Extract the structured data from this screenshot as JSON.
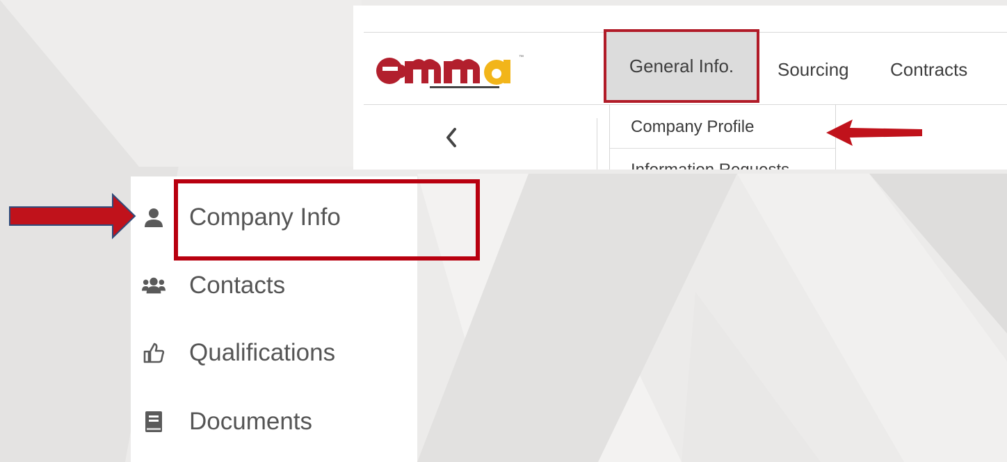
{
  "logo": {
    "text": "emma",
    "tagline": "maryland marketplace advantage",
    "icon": "emma-logo"
  },
  "nav": {
    "items": [
      {
        "label": "General Info.",
        "active": true
      },
      {
        "label": "Sourcing"
      },
      {
        "label": "Contracts"
      }
    ]
  },
  "back_button": {
    "icon": "chevron-left-icon"
  },
  "dropdown": {
    "items": [
      "Company Profile",
      "Information Requests"
    ]
  },
  "sidebar": {
    "items": [
      {
        "label": "Company Info",
        "icon": "user-icon",
        "highlighted": true
      },
      {
        "label": "Contacts",
        "icon": "users-icon"
      },
      {
        "label": "Qualifications",
        "icon": "thumbs-up-icon"
      },
      {
        "label": "Documents",
        "icon": "book-icon"
      }
    ]
  },
  "colors": {
    "highlight": "#b8000f",
    "arrow": "#c0121b",
    "logo_red": "#b21f2d",
    "logo_gold": "#f2b51a",
    "nav_active_bg": "#dcdcdc"
  }
}
